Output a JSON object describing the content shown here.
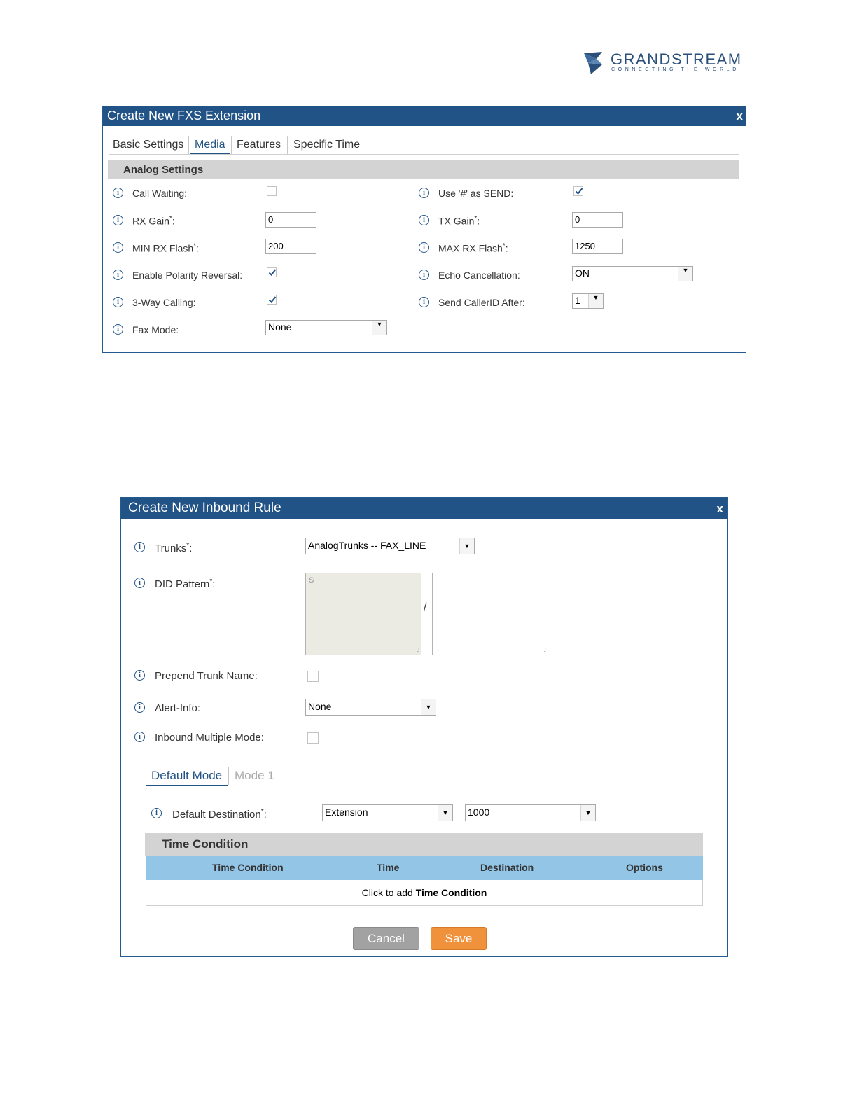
{
  "logo": {
    "name": "GRANDSTREAM",
    "tagline": "CONNECTING THE WORLD",
    "color": "#2b4f7b"
  },
  "fxs_dialog": {
    "title": "Create New FXS Extension",
    "close": "x",
    "tabs": [
      "Basic Settings",
      "Media",
      "Features",
      "Specific Time"
    ],
    "active_tab": "Media",
    "section": "Analog Settings",
    "call_waiting": {
      "label": "Call Waiting:",
      "checked": false
    },
    "use_hash": {
      "label": "Use '#' as SEND:",
      "checked": true
    },
    "rx_gain": {
      "label": "RX Gain",
      "required": "*",
      "colon": ":",
      "value": "0"
    },
    "tx_gain": {
      "label": "TX Gain",
      "required": "*",
      "colon": ":",
      "value": "0"
    },
    "min_rx_flash": {
      "label": "MIN RX Flash",
      "required": "*",
      "colon": ":",
      "value": "200"
    },
    "max_rx_flash": {
      "label": "MAX RX Flash",
      "required": "*",
      "colon": ":",
      "value": "1250"
    },
    "polarity_reversal": {
      "label": "Enable Polarity Reversal:",
      "checked": true
    },
    "echo_cancellation": {
      "label": "Echo Cancellation:",
      "value": "ON"
    },
    "three_way_calling": {
      "label": "3-Way Calling:",
      "checked": true
    },
    "send_callerid_after": {
      "label": "Send CallerID After:",
      "value": "1"
    },
    "fax_mode": {
      "label": "Fax Mode:",
      "value": "None"
    }
  },
  "inbound_dialog": {
    "title": "Create New Inbound Rule",
    "close": "x",
    "trunks": {
      "label": "Trunks",
      "required": "*",
      "colon": ":",
      "value": "AnalogTrunks -- FAX_LINE"
    },
    "did_pattern": {
      "label": "DID Pattern",
      "required": "*",
      "colon": ":",
      "placeholder": "S",
      "separator": "/"
    },
    "prepend_trunk_name": {
      "label": "Prepend Trunk Name:",
      "checked": false
    },
    "alert_info": {
      "label": "Alert-Info:",
      "value": "None"
    },
    "inbound_multiple_mode": {
      "label": "Inbound Multiple Mode:",
      "checked": false
    },
    "mode_tabs": [
      "Default Mode",
      "Mode 1"
    ],
    "active_mode": "Default Mode",
    "default_destination": {
      "label": "Default Destination",
      "required": "*",
      "colon": ":",
      "type": "Extension",
      "value": "1000"
    },
    "time_condition": {
      "section": "Time Condition",
      "columns": [
        "Time Condition",
        "Time",
        "Destination",
        "Options"
      ],
      "empty_prefix": "Click to add ",
      "empty_link": "Time Condition"
    },
    "buttons": {
      "cancel": "Cancel",
      "save": "Save"
    }
  },
  "colors": {
    "title_bar": "#225386",
    "table_header": "#93c5e6",
    "save": "#f0923b",
    "cancel": "#a2a2a2"
  }
}
